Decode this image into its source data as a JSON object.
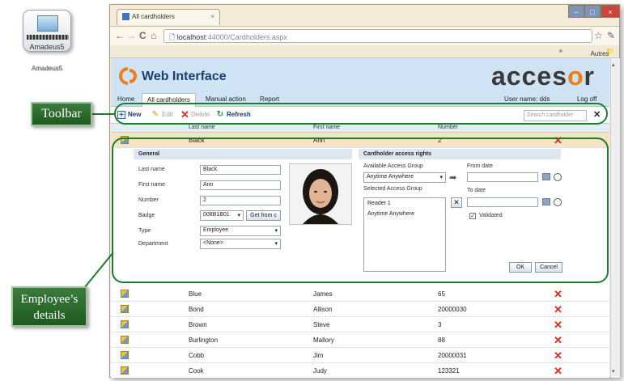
{
  "desktop": {
    "icon_label": "Amadeus5",
    "icon_shadow_label": "Amadeus5"
  },
  "browser": {
    "tab_title": "All cardholders",
    "url_host": "localhost",
    "url_path": ":44000/Cardholders.aspx",
    "bookmarks_label": "Autres favoris"
  },
  "app": {
    "title": "Web Interface",
    "brand_left": "acces",
    "brand_accent": "o",
    "brand_right": "r",
    "menu": [
      "Home",
      "All cardholders",
      "Manual action",
      "Report"
    ],
    "user_label": "User name: dds",
    "logoff_label": "Log off"
  },
  "toolbar": {
    "new": "New",
    "edit": "Edit",
    "delete": "Delete",
    "refresh": "Refresh",
    "search_placeholder": "Search cardholder"
  },
  "grid": {
    "columns": [
      "Last name",
      "First name",
      "Number"
    ],
    "selected": {
      "last": "Black",
      "first": "Ann",
      "number": "2"
    },
    "rows": [
      {
        "last": "Blue",
        "first": "James",
        "number": "65"
      },
      {
        "last": "Bond",
        "first": "Allison",
        "number": "20000030"
      },
      {
        "last": "Brown",
        "first": "Steve",
        "number": "3"
      },
      {
        "last": "Burlington",
        "first": "Mallory",
        "number": "88"
      },
      {
        "last": "Cobb",
        "first": "Jim",
        "number": "20000031"
      },
      {
        "last": "Cook",
        "first": "Judy",
        "number": "123321"
      }
    ]
  },
  "details": {
    "general_title": "General",
    "labels": {
      "last": "Last name",
      "first": "First name",
      "number": "Number",
      "badge": "Badge",
      "type": "Type",
      "department": "Department"
    },
    "values": {
      "last": "Black",
      "first": "Ann",
      "number": "2",
      "badge": "008B1B01",
      "type": "Employee",
      "department": "<None>"
    },
    "get_from_label": "Get from c",
    "access_title": "Cardholder access rights",
    "available_label": "Available Access Group",
    "available_value": "Anytime Anywhere",
    "selected_label": "Selected Access Group",
    "selected_items": [
      "Reader 1",
      "Anytime Anywhere"
    ],
    "from_label": "From date",
    "to_label": "To date",
    "validated_label": "Validated",
    "ok_label": "OK",
    "cancel_label": "Cancel"
  },
  "callouts": {
    "toolbar": "Toolbar",
    "details_line1": "Employee’s",
    "details_line2": "details"
  },
  "colors": {
    "accent": "#ef7d1a",
    "callout_green": "#1b7e2e",
    "header_blue": "#cfe3f4",
    "delete_red": "#e02a1a"
  }
}
